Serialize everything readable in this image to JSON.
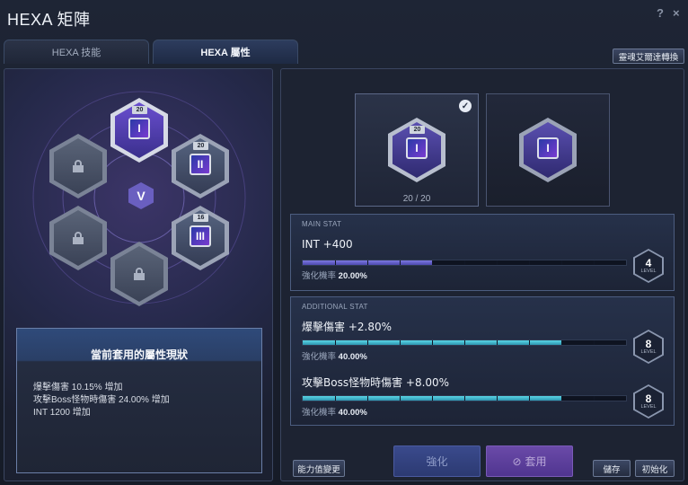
{
  "window": {
    "title": "HEXA 矩陣",
    "help": "?",
    "close": "×"
  },
  "tabs": [
    {
      "label": "HEXA 技能",
      "active": false
    },
    {
      "label": "HEXA 屬性",
      "active": true
    }
  ],
  "convert_button": "靈魂艾爾達轉換",
  "board": {
    "center_glyph": "V",
    "cores": [
      {
        "level": "20",
        "numeral": "I",
        "locked": false,
        "selected": true
      },
      {
        "level": "20",
        "numeral": "II",
        "locked": false,
        "selected": false
      },
      {
        "level": "16",
        "numeral": "III",
        "locked": false,
        "selected": false
      },
      {
        "locked": true
      },
      {
        "locked": true
      },
      {
        "locked": true
      }
    ]
  },
  "status": {
    "title": "當前套用的屬性現狀",
    "lines": [
      "爆擊傷害 10.15% 增加",
      "攻擊Boss怪物時傷害 24.00% 增加",
      "INT 1200 增加"
    ]
  },
  "slots": {
    "count": "20 / 20"
  },
  "main_stat": {
    "header": "MAIN STAT",
    "name": "INT +400",
    "rate_label": "強化機率",
    "rate_value": "20.00%",
    "level": "4",
    "level_label": "LEVEL",
    "progress": 0.4
  },
  "additional": {
    "header": "ADDITIONAL STAT",
    "stats": [
      {
        "name": "爆擊傷害 +2.80%",
        "rate_label": "強化機率",
        "rate_value": "40.00%",
        "level": "8",
        "level_label": "LEVEL",
        "progress": 0.8
      },
      {
        "name": "攻擊Boss怪物時傷害 +8.00%",
        "rate_label": "強化機率",
        "rate_value": "40.00%",
        "level": "8",
        "level_label": "LEVEL",
        "progress": 0.8
      }
    ]
  },
  "buttons": {
    "stat_change": "能力值變更",
    "enhance": "強化",
    "apply": "套用",
    "save": "儲存",
    "reset": "初始化"
  },
  "colors": {
    "accent": "#6b5fd0",
    "teal": "#4cc8dc"
  }
}
